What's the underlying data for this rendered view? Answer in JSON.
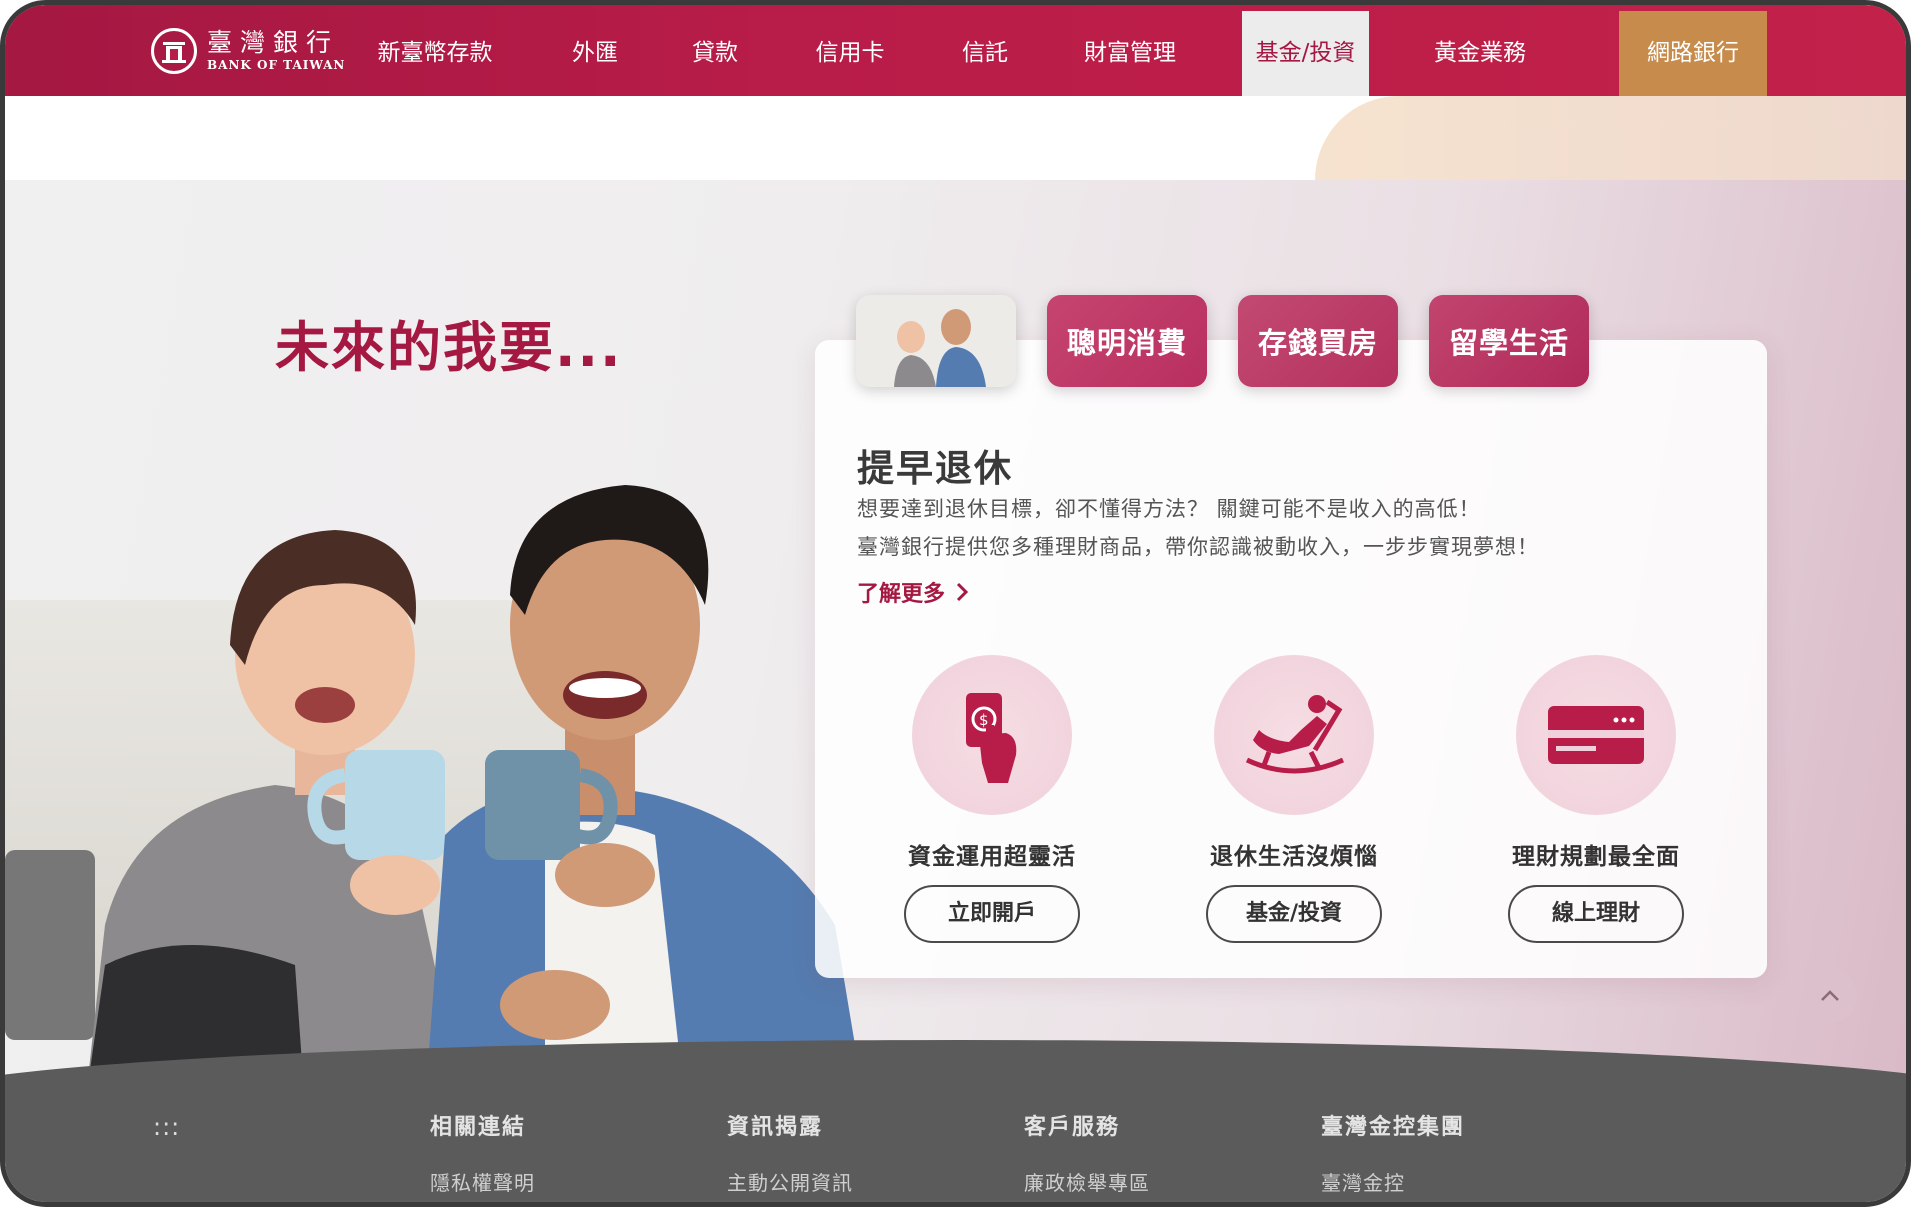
{
  "brand": {
    "name_cn": "臺灣銀行",
    "name_en": "BANK OF TAIWAN"
  },
  "nav": {
    "items": [
      "新臺幣存款",
      "外匯",
      "貸款",
      "信用卡",
      "信託",
      "財富管理",
      "基金/投資",
      "黃金業務"
    ],
    "active": "基金/投資",
    "ebank": "網路銀行"
  },
  "hero": {
    "headline": "未來的我要...",
    "tabs": [
      "聰明消費",
      "存錢買房",
      "留學生活"
    ],
    "card": {
      "title": "提早退休",
      "desc_line1": "想要達到退休目標，卻不懂得方法？ 關鍵可能不是收入的高低！",
      "desc_line2": "臺灣銀行提供您多種理財商品，帶你認識被動收入，一步步實現夢想！",
      "learn_more": "了解更多"
    },
    "features": [
      {
        "icon": "hand-money-icon",
        "label": "資金運用超靈活",
        "button": "立即開戶"
      },
      {
        "icon": "rocking-chair-icon",
        "label": "退休生活沒煩惱",
        "button": "基金/投資"
      },
      {
        "icon": "card-icon",
        "label": "理財規劃最全面",
        "button": "線上理財"
      }
    ]
  },
  "footer": {
    "more": ":::",
    "columns": [
      {
        "head": "相關連結",
        "link": "隱私權聲明"
      },
      {
        "head": "資訊揭露",
        "link": "主動公開資訊"
      },
      {
        "head": "客戶服務",
        "link": "廉政檢舉專區"
      },
      {
        "head": "臺灣金控集團",
        "link": "臺灣金控"
      }
    ]
  },
  "colors": {
    "brand": "#a41842",
    "ebank": "#c78b4c",
    "footer": "#5c5b5c"
  }
}
